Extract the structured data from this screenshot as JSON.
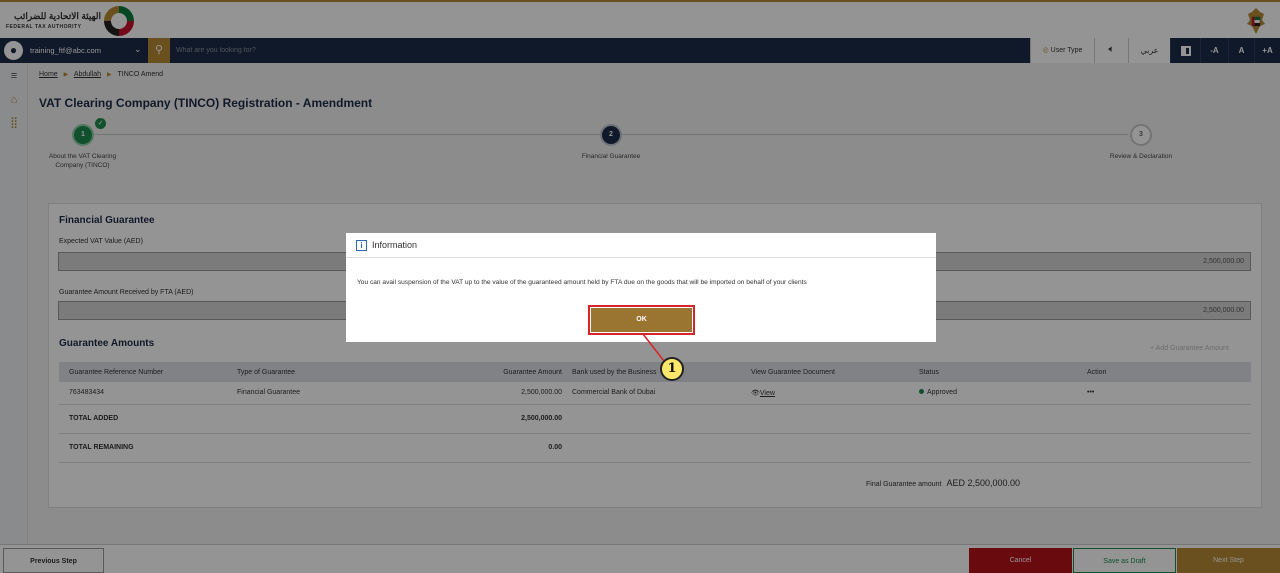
{
  "header": {
    "logo_ar": "الهيئة الاتحادية للضرائب",
    "logo_en": "FEDERAL TAX AUTHORITY"
  },
  "toolbar": {
    "user_email": "training_ftf@abc.com",
    "search_placeholder": "What are you looking for?",
    "user_type": "User Type",
    "arabic": "عربي",
    "font_minus": "-A",
    "font_normal": "A",
    "font_plus": "+A"
  },
  "breadcrumb": {
    "home": "Home",
    "user": "Abdullah",
    "current": "TINCO Amend"
  },
  "page_title": "VAT Clearing Company (TINCO) Registration - Amendment",
  "steps": [
    {
      "num": "1",
      "label": "About the VAT Clearing Company (TINCO)",
      "state": "completed"
    },
    {
      "num": "2",
      "label": "Financial Guarantee",
      "state": "active"
    },
    {
      "num": "3",
      "label": "Review & Declaration",
      "state": "pending"
    }
  ],
  "financial_guarantee": {
    "title": "Financial Guarantee",
    "expected_vat_label": "Expected VAT Value (AED)",
    "expected_vat_value": "2,500,000.00",
    "guarantee_received_label": "Guarantee Amount Received by FTA (AED)",
    "guarantee_received_value": "2,500,000.00"
  },
  "guarantee_amounts": {
    "title": "Guarantee Amounts",
    "add_link": "Add Guarantee Amount",
    "columns": [
      "Guarantee Reference Number",
      "Type of Guarantee",
      "Guarantee Amount",
      "Bank used by the Business",
      "View Guarantee Document",
      "Status",
      "Action"
    ],
    "rows": [
      {
        "ref": "763483434",
        "type": "Financial Guarantee",
        "amount": "2,500,000.00",
        "bank": "Commercial Bank of Dubai",
        "view": "View",
        "status": "Approved",
        "action": "•••"
      }
    ],
    "total_added_label": "TOTAL ADDED",
    "total_added_value": "2,500,000.00",
    "total_remaining_label": "TOTAL REMAINING",
    "total_remaining_value": "0.00",
    "final_label": "Final Guarantee amount",
    "final_value": "AED  2,500,000.00"
  },
  "footer": {
    "previous": "Previous Step",
    "cancel": "Cancel",
    "save_draft": "Save as Draft",
    "next": "Next Step"
  },
  "modal": {
    "title": "Information",
    "body": "You can avail suspension of the VAT up to the value of the guaranteed amount held by FTA due on the goods that will be imported on behalf of your clients",
    "ok": "OK"
  },
  "callout": {
    "number": "1"
  },
  "colors": {
    "brand_gold": "#b68a35",
    "navy": "#1c2c47",
    "success_green": "#1d8a4c",
    "danger_red": "#b5121b",
    "highlight_red": "#d8232a",
    "callout_yellow": "#fde86b"
  }
}
